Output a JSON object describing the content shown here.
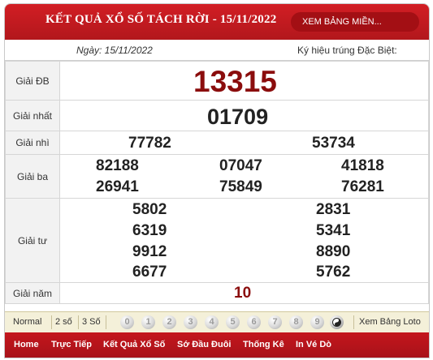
{
  "header": {
    "title": "KẾT QUẢ XỔ SỐ TÁCH RỜI - 15/11/2022",
    "view_button": "XEM BẢNG MIỀN..."
  },
  "date_bar": {
    "date": "Ngày: 15/11/2022",
    "special_symbol_label": "Ký hiệu trúng Đặc Biệt:"
  },
  "prizes": {
    "special": {
      "label": "Giải ĐB",
      "numbers": [
        "13315"
      ]
    },
    "first": {
      "label": "Giải nhất",
      "numbers": [
        "01709"
      ]
    },
    "second": {
      "label": "Giải nhì",
      "numbers": [
        "77782",
        "53734"
      ]
    },
    "third": {
      "label": "Giải ba",
      "numbers": [
        "82188",
        "07047",
        "41818",
        "26941",
        "75849",
        "76281"
      ]
    },
    "fourth": {
      "label": "Giải tư",
      "numbers": [
        "5802",
        "2831",
        "6319",
        "5341",
        "9912",
        "8890",
        "6677",
        "5762"
      ]
    },
    "fifth": {
      "label": "Giải năm",
      "numbers": [
        "10"
      ]
    }
  },
  "display_modes": {
    "normal": "Normal",
    "two_digits": "2 số",
    "three_digits": "3 Số",
    "digit_balls": [
      "0",
      "1",
      "2",
      "3",
      "4",
      "5",
      "6",
      "7",
      "8",
      "9"
    ],
    "all_icon": "yin-yang-icon",
    "view_loto": "Xem Bảng Loto"
  },
  "nav": {
    "items": [
      "Home",
      "Trực Tiếp",
      "Kết Quả Xổ Số",
      "Sớ Đầu Đuôi",
      "Thống Kê",
      "In Vé Dò"
    ]
  },
  "colors": {
    "brand_red": "#c4161c",
    "special_number": "#8b0d0d",
    "strip_background": "#f4f0d9"
  }
}
